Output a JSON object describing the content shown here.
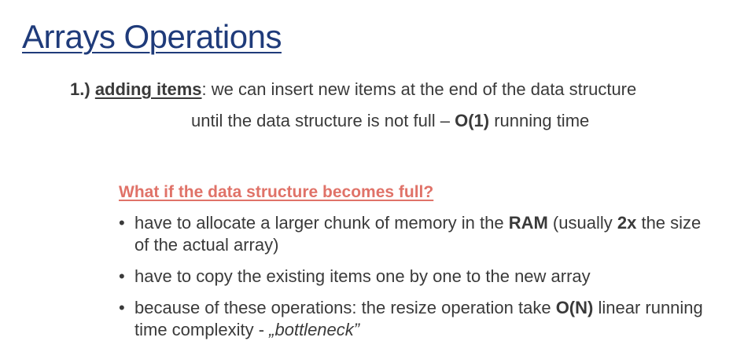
{
  "title": "Arrays Operations",
  "item1": {
    "number": "1.)",
    "heading": "adding items",
    "text_a": ": we can insert new items at the end of the data structure",
    "text_b": "until the data structure is not full – ",
    "complexity": "O(1)",
    "text_c": " running time"
  },
  "question": "What if the data structure becomes full?",
  "bullets": {
    "b1": {
      "a": "have to allocate a larger chunk of memory in the ",
      "ram": "RAM",
      "b": " (usually ",
      "factor": "2x",
      "c": " the size of the actual array)"
    },
    "b2": {
      "text": "have to copy the existing items one by one to the new array"
    },
    "b3": {
      "a": "because of these operations: the resize operation take ",
      "complexity": "O(N)",
      "b": " linear running time complexity - ",
      "quote": "„bottleneck”"
    }
  }
}
